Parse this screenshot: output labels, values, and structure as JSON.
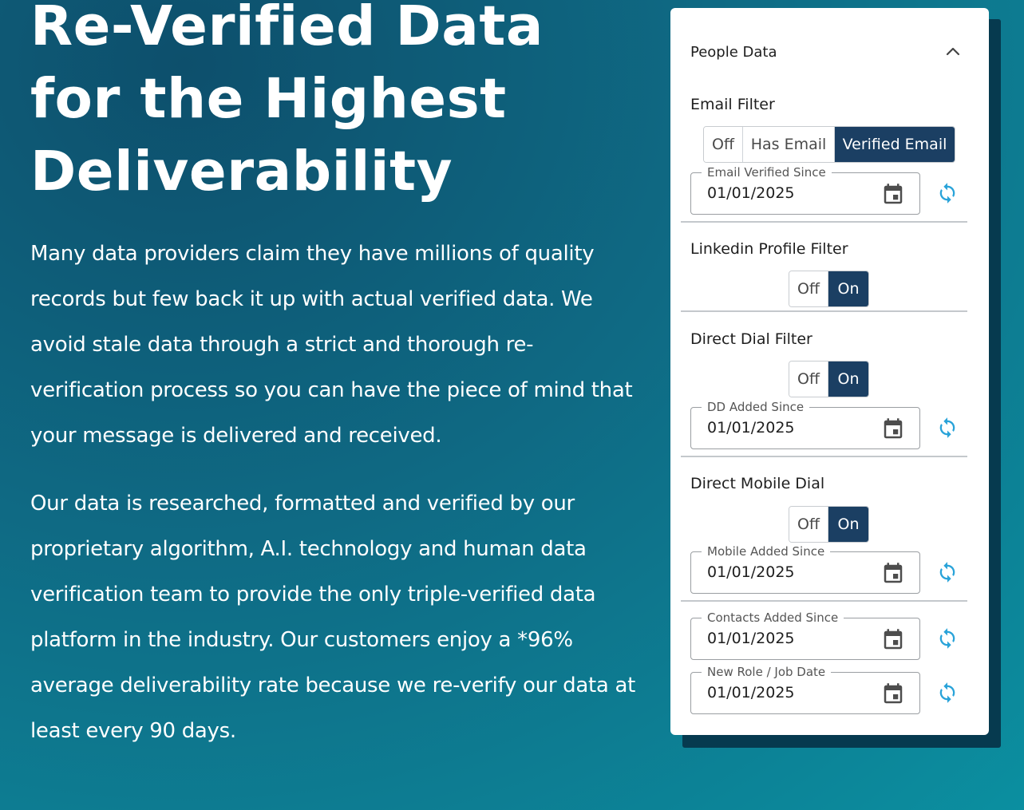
{
  "hero": {
    "title": [
      "Re-Verified Data",
      "for the Highest",
      "Deliverability"
    ],
    "paragraph1": "Many data providers claim they have millions of quality records but few back it up with actual verified data.  We avoid stale data through a strict and thorough re-verification process so you can have the piece of mind that your message is delivered and received.",
    "paragraph2": "Our data is researched, formatted and verified by our proprietary algorithm, A.I. technology and human data verification team to provide the only triple-verified data platform in the industry.  Our customers enjoy a *96% average deliverability rate because we re-verify our data at least every 90 days."
  },
  "panel": {
    "title": "People Data",
    "collapse_icon": "chevron-up-icon",
    "email_filter": {
      "label": "Email Filter",
      "options": [
        "Off",
        "Has Email",
        "Verified Email"
      ],
      "selected": "Verified Email",
      "date_label": "Email Verified Since",
      "date_value": "01/01/2025"
    },
    "linkedin_filter": {
      "label": "Linkedin Profile Filter",
      "options": [
        "Off",
        "On"
      ],
      "selected": "On"
    },
    "direct_dial_filter": {
      "label": "Direct Dial Filter",
      "options": [
        "Off",
        "On"
      ],
      "selected": "On",
      "date_label": "DD Added Since",
      "date_value": "01/01/2025"
    },
    "direct_mobile_dial": {
      "label": "Direct Mobile Dial",
      "options": [
        "Off",
        "On"
      ],
      "selected": "On",
      "date_label": "Mobile Added Since",
      "date_value": "01/01/2025"
    },
    "contacts_added": {
      "date_label": "Contacts Added Since",
      "date_value": "01/01/2025"
    },
    "new_role": {
      "date_label": "New Role / Job Date",
      "date_value": "01/01/2025"
    },
    "icons": {
      "calendar": "calendar-icon",
      "refresh": "refresh-icon"
    },
    "colors": {
      "active_toggle": "#1b3f63",
      "refresh_icon": "#29a3d9"
    }
  }
}
